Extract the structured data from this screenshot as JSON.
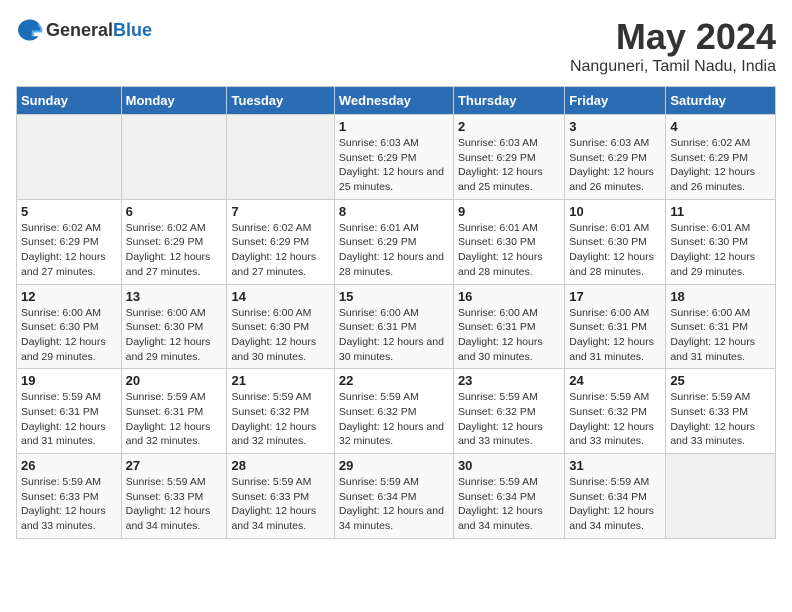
{
  "header": {
    "logo_general": "General",
    "logo_blue": "Blue",
    "title": "May 2024",
    "subtitle": "Nanguneri, Tamil Nadu, India"
  },
  "weekdays": [
    "Sunday",
    "Monday",
    "Tuesday",
    "Wednesday",
    "Thursday",
    "Friday",
    "Saturday"
  ],
  "weeks": [
    [
      {
        "day": "",
        "info": ""
      },
      {
        "day": "",
        "info": ""
      },
      {
        "day": "",
        "info": ""
      },
      {
        "day": "1",
        "info": "Sunrise: 6:03 AM\nSunset: 6:29 PM\nDaylight: 12 hours and 25 minutes."
      },
      {
        "day": "2",
        "info": "Sunrise: 6:03 AM\nSunset: 6:29 PM\nDaylight: 12 hours and 25 minutes."
      },
      {
        "day": "3",
        "info": "Sunrise: 6:03 AM\nSunset: 6:29 PM\nDaylight: 12 hours and 26 minutes."
      },
      {
        "day": "4",
        "info": "Sunrise: 6:02 AM\nSunset: 6:29 PM\nDaylight: 12 hours and 26 minutes."
      }
    ],
    [
      {
        "day": "5",
        "info": "Sunrise: 6:02 AM\nSunset: 6:29 PM\nDaylight: 12 hours and 27 minutes."
      },
      {
        "day": "6",
        "info": "Sunrise: 6:02 AM\nSunset: 6:29 PM\nDaylight: 12 hours and 27 minutes."
      },
      {
        "day": "7",
        "info": "Sunrise: 6:02 AM\nSunset: 6:29 PM\nDaylight: 12 hours and 27 minutes."
      },
      {
        "day": "8",
        "info": "Sunrise: 6:01 AM\nSunset: 6:29 PM\nDaylight: 12 hours and 28 minutes."
      },
      {
        "day": "9",
        "info": "Sunrise: 6:01 AM\nSunset: 6:30 PM\nDaylight: 12 hours and 28 minutes."
      },
      {
        "day": "10",
        "info": "Sunrise: 6:01 AM\nSunset: 6:30 PM\nDaylight: 12 hours and 28 minutes."
      },
      {
        "day": "11",
        "info": "Sunrise: 6:01 AM\nSunset: 6:30 PM\nDaylight: 12 hours and 29 minutes."
      }
    ],
    [
      {
        "day": "12",
        "info": "Sunrise: 6:00 AM\nSunset: 6:30 PM\nDaylight: 12 hours and 29 minutes."
      },
      {
        "day": "13",
        "info": "Sunrise: 6:00 AM\nSunset: 6:30 PM\nDaylight: 12 hours and 29 minutes."
      },
      {
        "day": "14",
        "info": "Sunrise: 6:00 AM\nSunset: 6:30 PM\nDaylight: 12 hours and 30 minutes."
      },
      {
        "day": "15",
        "info": "Sunrise: 6:00 AM\nSunset: 6:31 PM\nDaylight: 12 hours and 30 minutes."
      },
      {
        "day": "16",
        "info": "Sunrise: 6:00 AM\nSunset: 6:31 PM\nDaylight: 12 hours and 30 minutes."
      },
      {
        "day": "17",
        "info": "Sunrise: 6:00 AM\nSunset: 6:31 PM\nDaylight: 12 hours and 31 minutes."
      },
      {
        "day": "18",
        "info": "Sunrise: 6:00 AM\nSunset: 6:31 PM\nDaylight: 12 hours and 31 minutes."
      }
    ],
    [
      {
        "day": "19",
        "info": "Sunrise: 5:59 AM\nSunset: 6:31 PM\nDaylight: 12 hours and 31 minutes."
      },
      {
        "day": "20",
        "info": "Sunrise: 5:59 AM\nSunset: 6:31 PM\nDaylight: 12 hours and 32 minutes."
      },
      {
        "day": "21",
        "info": "Sunrise: 5:59 AM\nSunset: 6:32 PM\nDaylight: 12 hours and 32 minutes."
      },
      {
        "day": "22",
        "info": "Sunrise: 5:59 AM\nSunset: 6:32 PM\nDaylight: 12 hours and 32 minutes."
      },
      {
        "day": "23",
        "info": "Sunrise: 5:59 AM\nSunset: 6:32 PM\nDaylight: 12 hours and 33 minutes."
      },
      {
        "day": "24",
        "info": "Sunrise: 5:59 AM\nSunset: 6:32 PM\nDaylight: 12 hours and 33 minutes."
      },
      {
        "day": "25",
        "info": "Sunrise: 5:59 AM\nSunset: 6:33 PM\nDaylight: 12 hours and 33 minutes."
      }
    ],
    [
      {
        "day": "26",
        "info": "Sunrise: 5:59 AM\nSunset: 6:33 PM\nDaylight: 12 hours and 33 minutes."
      },
      {
        "day": "27",
        "info": "Sunrise: 5:59 AM\nSunset: 6:33 PM\nDaylight: 12 hours and 34 minutes."
      },
      {
        "day": "28",
        "info": "Sunrise: 5:59 AM\nSunset: 6:33 PM\nDaylight: 12 hours and 34 minutes."
      },
      {
        "day": "29",
        "info": "Sunrise: 5:59 AM\nSunset: 6:34 PM\nDaylight: 12 hours and 34 minutes."
      },
      {
        "day": "30",
        "info": "Sunrise: 5:59 AM\nSunset: 6:34 PM\nDaylight: 12 hours and 34 minutes."
      },
      {
        "day": "31",
        "info": "Sunrise: 5:59 AM\nSunset: 6:34 PM\nDaylight: 12 hours and 34 minutes."
      },
      {
        "day": "",
        "info": ""
      }
    ]
  ]
}
